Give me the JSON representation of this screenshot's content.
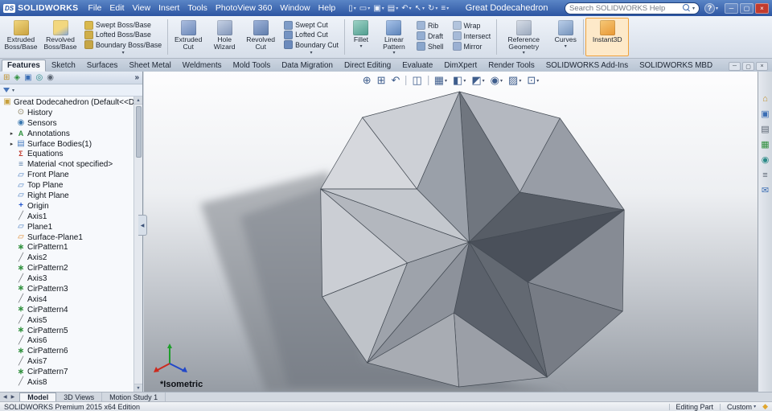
{
  "colors": {
    "titlebar_blue": "#2d55a2",
    "ribbon_bg": "#dde4ee",
    "accent_orange": "#f0a23c",
    "viewport_top": "#fdfdfe",
    "viewport_bottom": "#969ca4",
    "model_gray": "#9aa0a9"
  },
  "icons": {
    "dropdown": "▾",
    "expand_arrow": "▸",
    "overflow": "»",
    "panel_collapse": "◀",
    "scroll_up": "▲",
    "scroll_down": "▼",
    "tab_prev": "◀",
    "tab_next": "▶",
    "help": "?",
    "minimize": "─",
    "restore": "▢",
    "close": "×",
    "new_doc": "▯",
    "open_doc": "▭",
    "save_doc": "▣",
    "print_doc": "▤",
    "undo": "↶",
    "select_arrow": "↖",
    "rebuild": "↻",
    "options": "≡",
    "fm_tree": "⊞",
    "fm_props": "◈",
    "fm_config": "▣",
    "fm_dimx": "◎",
    "fm_display": "◉",
    "hud_zoom_fit": "⊕",
    "hud_zoom_area": "⊞",
    "hud_prev": "↶",
    "hud_section": "◫",
    "hud_orientation": "▦",
    "hud_display": "◧",
    "hud_hide_show": "◩",
    "hud_appearance": "◉",
    "hud_scene": "▨",
    "hud_settings": "⊡",
    "pane_resources": "⌂",
    "pane_library": "▣",
    "pane_explorer": "▤",
    "pane_palette": "▦",
    "pane_appearances": "◉",
    "pane_props": "≡",
    "pane_forum": "✉"
  },
  "titlebar": {
    "logo_ds": "DS",
    "logo_text": "SOLIDWORKS",
    "menus": [
      "File",
      "Edit",
      "View",
      "Insert",
      "Tools",
      "PhotoView 360",
      "Window",
      "Help"
    ],
    "document_title": "Great Dodecahedron",
    "search_placeholder": "Search SOLIDWORKS Help"
  },
  "ribbon": {
    "extruded_boss": "Extruded Boss/Base",
    "revolved_boss": "Revolved Boss/Base",
    "swept_boss": "Swept Boss/Base",
    "lofted_boss": "Lofted Boss/Base",
    "boundary_boss": "Boundary Boss/Base",
    "extruded_cut": "Extruded Cut",
    "hole_wizard": "Hole Wizard",
    "revolved_cut": "Revolved Cut",
    "swept_cut": "Swept Cut",
    "lofted_cut": "Lofted Cut",
    "boundary_cut": "Boundary Cut",
    "fillet": "Fillet",
    "linear_pattern": "Linear Pattern",
    "rib": "Rib",
    "draft": "Draft",
    "shell": "Shell",
    "wrap": "Wrap",
    "intersect": "Intersect",
    "mirror": "Mirror",
    "reference_geometry": "Reference Geometry",
    "curves": "Curves",
    "instant3d": "Instant3D"
  },
  "command_tabs": [
    {
      "label": "Features",
      "state": "active"
    },
    {
      "label": "Sketch"
    },
    {
      "label": "Surfaces"
    },
    {
      "label": "Sheet Metal"
    },
    {
      "label": "Weldments"
    },
    {
      "label": "Mold Tools"
    },
    {
      "label": "Data Migration"
    },
    {
      "label": "Direct Editing"
    },
    {
      "label": "Evaluate"
    },
    {
      "label": "DimXpert"
    },
    {
      "label": "Render Tools"
    },
    {
      "label": "SOLIDWORKS Add-Ins"
    },
    {
      "label": "SOLIDWORKS MBD"
    }
  ],
  "tree": {
    "root": {
      "label": "Great Dodecahedron (Default<<Default",
      "icon": "part"
    },
    "items": [
      {
        "label": "History",
        "icon": "history"
      },
      {
        "label": "Sensors",
        "icon": "sensors"
      },
      {
        "label": "Annotations",
        "icon": "annotations",
        "expandable": true
      },
      {
        "label": "Surface Bodies(1)",
        "icon": "bodies",
        "expandable": true
      },
      {
        "label": "Equations",
        "icon": "equations"
      },
      {
        "label": "Material <not specified>",
        "icon": "material"
      },
      {
        "label": "Front Plane",
        "icon": "plane"
      },
      {
        "label": "Top Plane",
        "icon": "plane"
      },
      {
        "label": "Right Plane",
        "icon": "plane"
      },
      {
        "label": "Origin",
        "icon": "origin"
      },
      {
        "label": "Axis1",
        "icon": "axis"
      },
      {
        "label": "Plane1",
        "icon": "plane"
      },
      {
        "label": "Surface-Plane1",
        "icon": "surfplane"
      },
      {
        "label": "CirPattern1",
        "icon": "cirpattern"
      },
      {
        "label": "Axis2",
        "icon": "axis"
      },
      {
        "label": "CirPattern2",
        "icon": "cirpattern"
      },
      {
        "label": "Axis3",
        "icon": "axis"
      },
      {
        "label": "CirPattern3",
        "icon": "cirpattern"
      },
      {
        "label": "Axis4",
        "icon": "axis"
      },
      {
        "label": "CirPattern4",
        "icon": "cirpattern"
      },
      {
        "label": "Axis5",
        "icon": "axis"
      },
      {
        "label": "CirPattern5",
        "icon": "cirpattern"
      },
      {
        "label": "Axis6",
        "icon": "axis"
      },
      {
        "label": "CirPattern6",
        "icon": "cirpattern"
      },
      {
        "label": "Axis7",
        "icon": "axis"
      },
      {
        "label": "CirPattern7",
        "icon": "cirpattern"
      },
      {
        "label": "Axis8",
        "icon": "axis"
      }
    ]
  },
  "viewport": {
    "view_label": "*Isometric"
  },
  "document_tabs": [
    {
      "label": "Model",
      "state": "active"
    },
    {
      "label": "3D Views"
    },
    {
      "label": "Motion Study 1"
    }
  ],
  "statusbar": {
    "left": "SOLIDWORKS Premium 2015 x64 Edition",
    "editing": "Editing Part",
    "config": "Custom"
  }
}
